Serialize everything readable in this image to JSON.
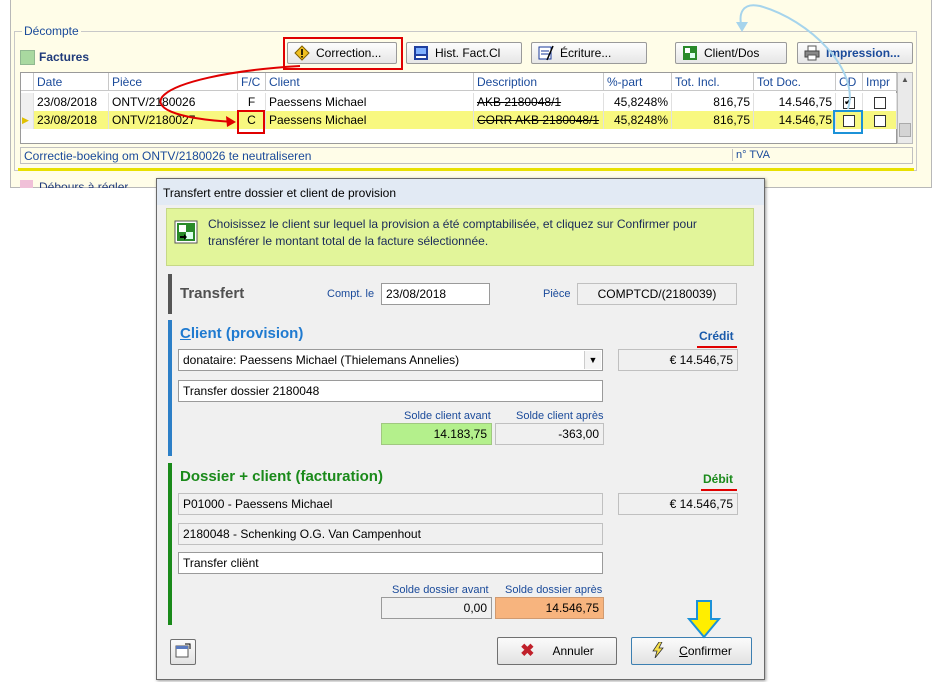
{
  "main": {
    "section_title": "Décompte",
    "factures_label": "Factures",
    "toolbar": {
      "correction_label": "Correction...",
      "hist_label": "Hist. Fact.Cl",
      "ecriture_label": "Écriture...",
      "client_dos_label": "Client/Dos",
      "impression_label": "Impression..."
    },
    "grid": {
      "headers": [
        "Date",
        "Pièce",
        "F/C",
        "Client",
        "Description",
        "%-part",
        "Tot. Incl.",
        "Tot Doc.",
        "CD",
        "Impr"
      ],
      "rows": [
        {
          "date": "23/08/2018",
          "piece": "ONTV/2180026",
          "fc": "F",
          "client": "Paessens Michael",
          "description": "AKB 2180048/1",
          "part": "45,8248%",
          "tot_incl": "816,75",
          "tot_doc": "14.546,75",
          "cd": true,
          "impr": false
        },
        {
          "date": "23/08/2018",
          "piece": "ONTV/2180027",
          "fc": "C",
          "client": "Paessens Michael",
          "description": "CORR AKB 2180048/1",
          "part": "45,8248%",
          "tot_incl": "816,75",
          "tot_doc": "14.546,75",
          "cd": false,
          "impr": false
        }
      ]
    },
    "status_text": "Correctie-boeking om ONTV/2180026 te neutraliseren",
    "tva_label": "n° TVA",
    "debours_label": "Débours à régler"
  },
  "dialog": {
    "title": "Transfert entre dossier et client de provision",
    "info_text": "Choisissez le client sur lequel la provision a été comptabilisée, et cliquez sur Confirmer pour transférer le montant total de la facture sélectionnée.",
    "transfert": {
      "label": "Transfert",
      "compt_label": "Compt. le",
      "compt_value": "23/08/2018",
      "piece_label": "Pièce",
      "piece_value": "COMPTCD/(2180039)"
    },
    "client": {
      "title_first": "C",
      "title_rest": "lient (provision)",
      "credit_label": "Crédit",
      "select_value": "donataire: Paessens Michael (Thielemans Annelies)",
      "amount": "€ 14.546,75",
      "comment": "Transfer dossier 2180048",
      "solde_avant_label": "Solde client avant",
      "solde_apres_label": "Solde client après",
      "solde_avant": "14.183,75",
      "solde_apres": "-363,00"
    },
    "dossier": {
      "title": "Dossier + client (facturation)",
      "debit_label": "Débit",
      "client_value": "P01000 - Paessens Michael",
      "amount": "€ 14.546,75",
      "dossier_value": "2180048 - Schenking O.G. Van Campenhout",
      "comment": "Transfer cliënt",
      "solde_avant_label": "Solde dossier avant",
      "solde_apres_label": "Solde dossier après",
      "solde_avant": "0,00",
      "solde_apres": "14.546,75"
    },
    "buttons": {
      "annuler": "Annuler",
      "confirmer_first": "C",
      "confirmer_rest": "onfirmer"
    }
  },
  "colors": {
    "accent_blue": "#1f7ad0",
    "green": "#1a8a1a",
    "highlight_red": "#e00000",
    "callout_blue": "#1c92d8",
    "arrow_yellow": "#ffee00",
    "info_bg": "#e2f59a",
    "solde_green": "#b4f08c",
    "solde_orange": "#f7b47e"
  }
}
